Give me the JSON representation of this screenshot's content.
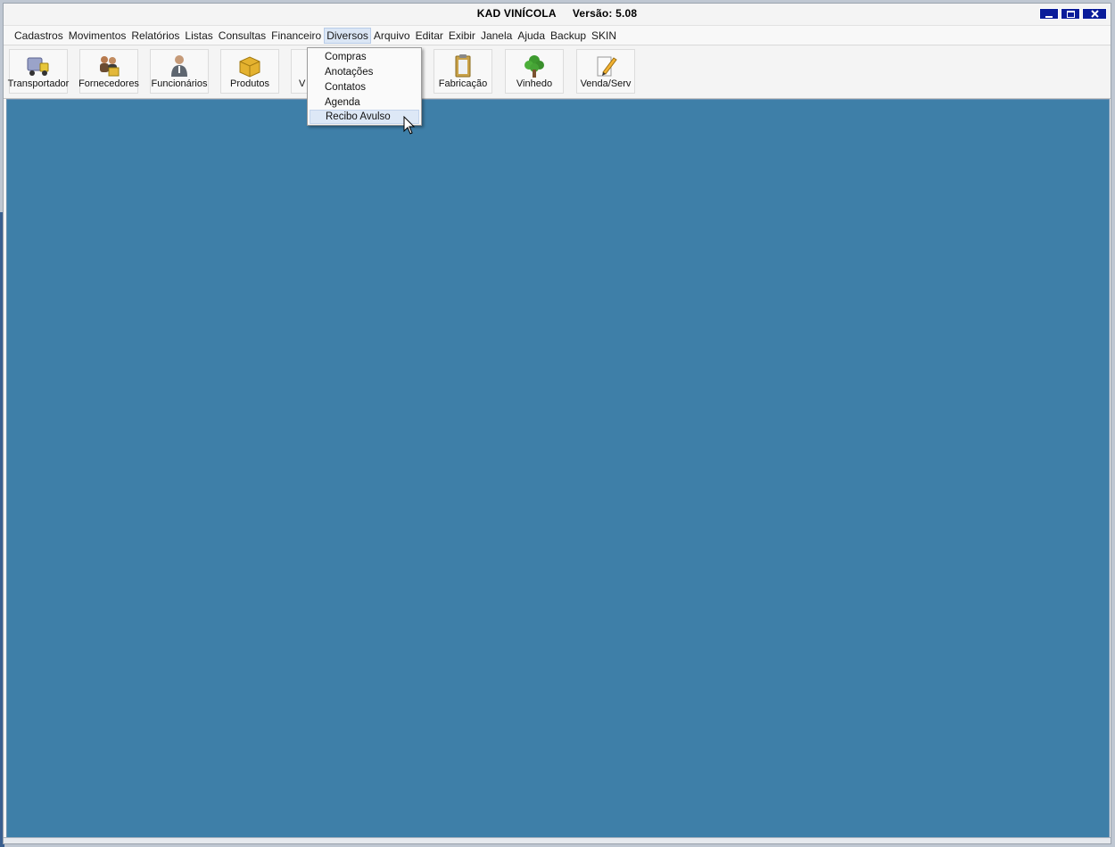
{
  "window": {
    "title": "KAD VINÍCOLA",
    "version": "Versão: 5.08",
    "controls": [
      "minimize",
      "maximize",
      "close"
    ]
  },
  "menubar": {
    "items": [
      "Cadastros",
      "Movimentos",
      "Relatórios",
      "Listas",
      "Consultas",
      "Financeiro",
      "Diversos",
      "Arquivo",
      "Editar",
      "Exibir",
      "Janela",
      "Ajuda",
      "Backup",
      "SKIN"
    ],
    "active": "Diversos"
  },
  "toolbar": {
    "buttons": [
      {
        "label": "Transportador",
        "icon": "truck-icon"
      },
      {
        "label": "Fornecedores",
        "icon": "suppliers-icon"
      },
      {
        "label": "Funcionários",
        "icon": "employee-icon"
      },
      {
        "label": "Produtos",
        "icon": "box-icon"
      },
      {
        "label": "V",
        "icon": "wine-icon"
      },
      {
        "label": "Fabricação",
        "icon": "clipboard-icon"
      },
      {
        "label": "Vinhedo",
        "icon": "tree-icon"
      },
      {
        "label": "Venda/Serv",
        "icon": "pencil-note-icon"
      }
    ]
  },
  "dropdown": {
    "items": [
      "Compras",
      "Anotações",
      "Contatos",
      "Agenda",
      "Recibo Avulso"
    ],
    "highlighted": "Recibo Avulso"
  },
  "colors": {
    "workspace": "#3e7fa8",
    "window_button": "#0a1c9a",
    "menu_highlight": "#dde8f6"
  }
}
